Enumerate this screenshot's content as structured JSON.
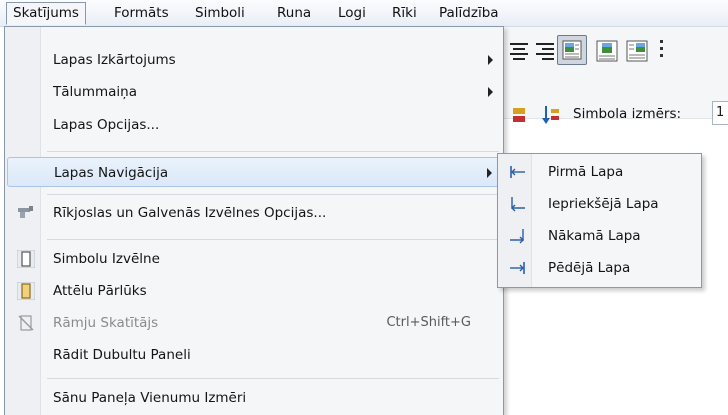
{
  "menubar": {
    "items": [
      "Skatījums",
      "Formāts",
      "Simboli",
      "Runa",
      "Logi",
      "Rīki",
      "Palīdzība"
    ]
  },
  "toolbar": {
    "symbol_size_label": "Simbola izmērs:",
    "symbol_size_value": "1"
  },
  "menu": {
    "items": [
      {
        "label": "Lapas Izkārtojums"
      },
      {
        "label": "Tālummaiņa"
      },
      {
        "label": "Lapas Opcijas..."
      },
      {
        "label": "Lapas Navigācija"
      },
      {
        "label": "Rīkjoslas un Galvenās Izvēlnes Opcijas..."
      },
      {
        "label": "Simbolu Izvēlne"
      },
      {
        "label": "Attēlu Pārlūks"
      },
      {
        "label": "Rāmju Skatītājs",
        "shortcut": "Ctrl+Shift+G"
      },
      {
        "label": "Rādit Dubultu Paneli"
      },
      {
        "label": "Sānu Paneļa Vienumu Izmēri"
      }
    ]
  },
  "submenu": {
    "items": [
      {
        "label": "Pirmā Lapa"
      },
      {
        "label": "Iepriekšējā Lapa"
      },
      {
        "label": "Nākamā Lapa"
      },
      {
        "label": "Pēdējā Lapa"
      }
    ]
  },
  "icons": {
    "toolbar": [
      "align-center-icon",
      "align-right-icon",
      "image-left-icon",
      "image-center-icon",
      "image-right-icon",
      "symbol-order-icon",
      "sort-down-icon"
    ],
    "menu": [
      "toolbar-options-icon",
      "symbol-menu-icon",
      "image-browser-icon",
      "frame-viewer-icon"
    ],
    "submenu": [
      "first-page-icon",
      "previous-page-icon",
      "next-page-icon",
      "last-page-icon"
    ]
  },
  "colors": {
    "highlight_border": "#a8c4e8",
    "highlight_fill": "#dbe8f9",
    "menu_border": "#8a98ab",
    "disabled_text": "#8b8b8b"
  }
}
